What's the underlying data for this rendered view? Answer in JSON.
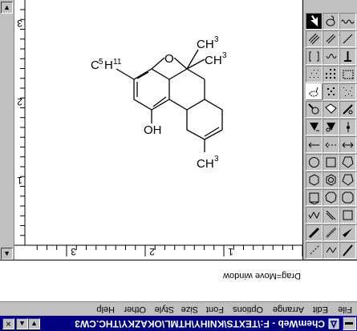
{
  "window": {
    "title": "ChemWeb - F:\\TEXTS\\KNIHY\\HTML\\OKAZKY\\THC.CW3"
  },
  "menu": [
    "File",
    "Edit",
    "Arrange",
    "Options",
    "Font",
    "Size",
    "Style",
    "Other",
    "Help"
  ],
  "status": {
    "message": "Drag=Move window"
  },
  "ruler": {
    "horizontal_labels": [
      "1",
      "2",
      "3"
    ],
    "vertical_labels": [
      "1",
      "2",
      "3"
    ]
  },
  "molecule": {
    "labels": {
      "ch3_top": "CH",
      "ch3_top_sub": "3",
      "oh": "OH",
      "c5h11": "C",
      "c5h11_sub1": "5",
      "c5h11_h": "H",
      "c5h11_sub2": "11",
      "o_ring": "O",
      "ch3_a": "CH",
      "ch3_a_sub": "3",
      "ch3_b": "CH",
      "ch3_b_sub": "3"
    }
  },
  "palette": {
    "tool_names": [
      "select-arrow",
      "lasso",
      "wave-bond",
      "ring-small",
      "bond-single",
      "bond-dash",
      "arrow-tool",
      "arrow-double",
      "bond-wedge"
    ]
  },
  "colors": {
    "title_bar": "#000080",
    "chrome": "#c0c0c0",
    "canvas": "#ffffff"
  }
}
